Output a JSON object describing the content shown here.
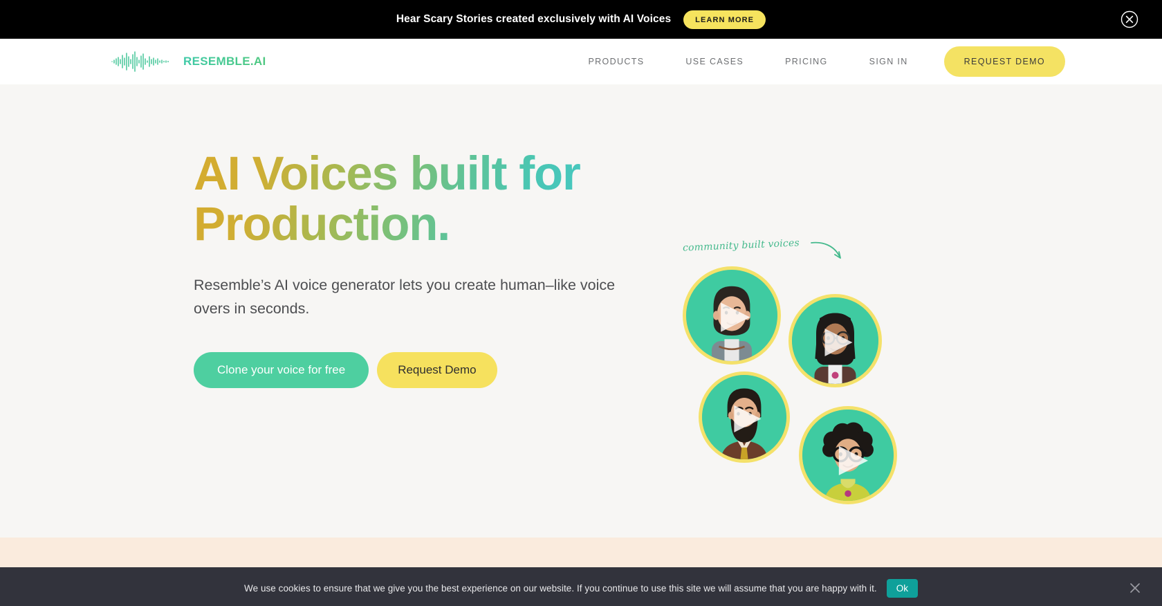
{
  "promo_banner": {
    "message": "Hear Scary Stories created exclusively with AI Voices",
    "cta_label": "LEARN MORE",
    "close_icon": "close-circle-icon",
    "background_color": "#000000",
    "cta_color": "#f6e35e"
  },
  "header": {
    "logo": {
      "text": "RESEMBLE.AI",
      "icon": "waveform-icon",
      "gradient_from": "#3ec9a7",
      "gradient_to": "#4fc77f"
    },
    "nav": [
      {
        "label": "PRODUCTS"
      },
      {
        "label": "USE CASES"
      },
      {
        "label": "PRICING"
      },
      {
        "label": "SIGN IN"
      }
    ],
    "demo_button": {
      "label": "REQUEST DEMO",
      "background_color": "#f4e263"
    }
  },
  "hero": {
    "headline_line1": "AI Voices built for",
    "headline_line2": "Production.",
    "headline_gradient_start": "#d6ab2e",
    "headline_gradient_mid": "#7cc077",
    "headline_gradient_end": "#45c9cd",
    "subtitle": "Resemble’s AI voice generator lets you create human–like voice overs in seconds.",
    "primary_cta": {
      "label": "Clone your voice for free",
      "background_color": "#4ecfa0",
      "text_color": "#ffffff"
    },
    "secondary_cta": {
      "label": "Request Demo",
      "background_color": "#f6e15e",
      "text_color": "#2f2f2f"
    },
    "background_color": "#f7f6f4"
  },
  "hero_art": {
    "caption": "community built voices",
    "caption_color": "#44b98c",
    "arrow_icon": "curved-arrow-icon",
    "avatar_ring_color": "#f4e16a",
    "avatar_background_color": "#3fcba1",
    "avatars": [
      {
        "name": "avatar-woman-bob-haircut",
        "play_overlay": "play-triangle-icon"
      },
      {
        "name": "avatar-woman-glasses-braids",
        "play_overlay": "play-triangle-icon"
      },
      {
        "name": "avatar-bearded-man-suit",
        "play_overlay": "play-triangle-icon"
      },
      {
        "name": "avatar-person-curly-hair-glasses",
        "play_overlay": "play-triangle-icon"
      }
    ]
  },
  "cream_section": {
    "background_color": "#faebdd"
  },
  "cookie_bar": {
    "message": "We use cookies to ensure that we give you the best experience on our website. If you continue to use this site we will assume that you are happy with it.",
    "ok_label": "Ok",
    "close_icon": "close-icon",
    "background_color": "#32333c",
    "ok_button_color": "#0fa09a"
  }
}
